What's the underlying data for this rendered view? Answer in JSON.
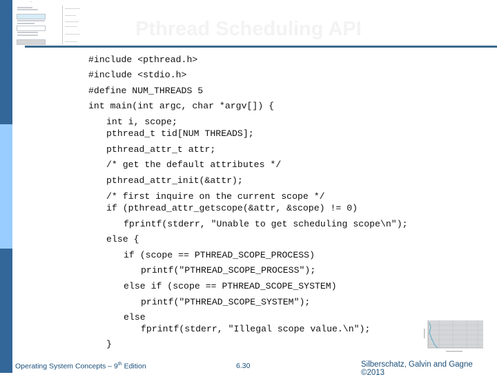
{
  "slide": {
    "title": "Pthread Scheduling API",
    "code_lines": [
      {
        "indent": 0,
        "text": "#include <pthread.h>"
      },
      {
        "indent": 0,
        "text": "#include <stdio.h>"
      },
      {
        "indent": 0,
        "text": "#define NUM_THREADS 5"
      },
      {
        "indent": 0,
        "text": "int main(int argc, char *argv[]) {"
      },
      {
        "indent": 1,
        "text": "int i, scope;"
      },
      {
        "indent": 1,
        "text": "pthread_t tid[NUM THREADS];"
      },
      {
        "indent": 1,
        "text": "pthread_attr_t attr;"
      },
      {
        "indent": 1,
        "text": "/* get the default attributes */"
      },
      {
        "indent": 1,
        "text": "pthread_attr_init(&attr);"
      },
      {
        "indent": 1,
        "text": "/* first inquire on the current scope */"
      },
      {
        "indent": 1,
        "text": "if (pthread_attr_getscope(&attr, &scope) != 0)"
      },
      {
        "indent": 2,
        "text": "fprintf(stderr, \"Unable to get scheduling scope\\n\");"
      },
      {
        "indent": 1,
        "text": "else {"
      },
      {
        "indent": 2,
        "text": "if (scope == PTHREAD_SCOPE_PROCESS)"
      },
      {
        "indent": 3,
        "text": "printf(\"PTHREAD_SCOPE_PROCESS\");"
      },
      {
        "indent": 2,
        "text": "else if (scope == PTHREAD_SCOPE_SYSTEM)"
      },
      {
        "indent": 3,
        "text": "printf(\"PTHREAD_SCOPE_SYSTEM\");"
      },
      {
        "indent": 2,
        "text": "else"
      },
      {
        "indent": 3,
        "text": "fprintf(stderr, \"Illegal scope value.\\n\");"
      },
      {
        "indent": 1,
        "text": "}"
      }
    ]
  },
  "footer": {
    "book": "Operating System Concepts – 9",
    "edition_sup": "th",
    "edition_word": " Edition",
    "page": "6.30",
    "copyright": "Silberschatz, Galvin and Gagne ©2013"
  },
  "colors": {
    "sidebar_dark": "#336699",
    "sidebar_light": "#99ccff",
    "rule": "#3a6a8c",
    "footer_text": "#1a4f7a",
    "title_text": "#f3f3f3"
  }
}
